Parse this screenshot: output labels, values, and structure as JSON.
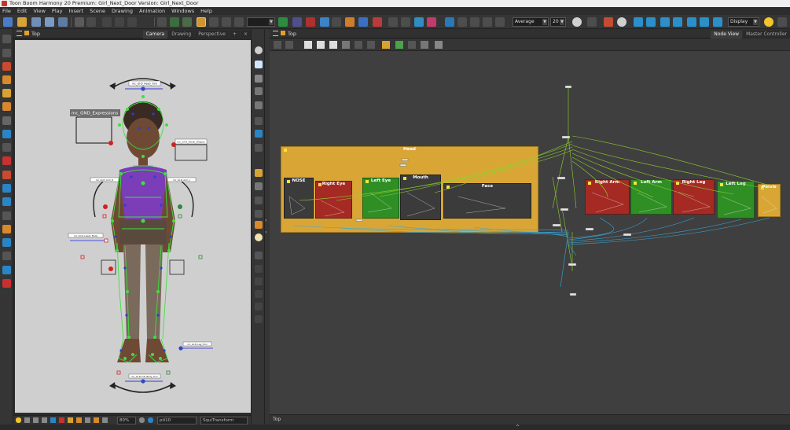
{
  "window": {
    "title": "Toon Boom Harmony 20 Premium: Girl_Next_Door Version: Girl_Next_Door"
  },
  "menu": [
    "File",
    "Edit",
    "View",
    "Play",
    "Insert",
    "Scene",
    "Drawing",
    "Animation",
    "Windows",
    "Help"
  ],
  "toolbar": {
    "blend_mode": "Average",
    "value": "20",
    "display": "Display"
  },
  "camera_view": {
    "title": "Top",
    "tabs": [
      "Camera",
      "Drawing",
      "Perspective"
    ],
    "active_tab": "Camera",
    "status": {
      "zoom": "80%",
      "frame": "pti10",
      "transform_tool": "SquiTransform"
    },
    "rig_labels": {
      "expressions": "mc_GND_Expressions",
      "head": "mc_GI-D_Head_Turn",
      "facial": "mc_GI-D_Facial_Shapes",
      "arm_r": "mc_GI-D_Arm_R",
      "arm_l": "mc_GI-D_Arm_L",
      "lower_body": "mc_GI-D_Lower_Body",
      "leg": "mc_GI-D_Leg_Turn",
      "full_body": "mc_GI-D_Full_Body_Turn"
    }
  },
  "node_view": {
    "title": "Top",
    "tabs": [
      "Node View",
      "Master Controller"
    ],
    "active_tab": "Node View",
    "status": "Top",
    "backdrops": {
      "head": "Head",
      "nose": "NOSE",
      "right_eye": "Right Eye",
      "left_eye": "Left Eye",
      "mouth": "Mouth",
      "face": "Face",
      "right_arm": "Right Arm",
      "left_arm": "Left Arm",
      "right_leg": "Right Leg",
      "left_leg": "Left Leg",
      "pelvis": "Pelvis"
    }
  },
  "colors": {
    "backdrop_orange": "#d9a636",
    "backdrop_red": "#a52a24",
    "backdrop_green": "#2f8f25",
    "backdrop_dark": "#3b3b3b",
    "wire_green": "#8ed12c",
    "wire_blue": "#3aa7d9",
    "rig_green": "#3ee03e",
    "rig_purple": "#7b3db8",
    "rig_blue": "#2a3fcf"
  }
}
